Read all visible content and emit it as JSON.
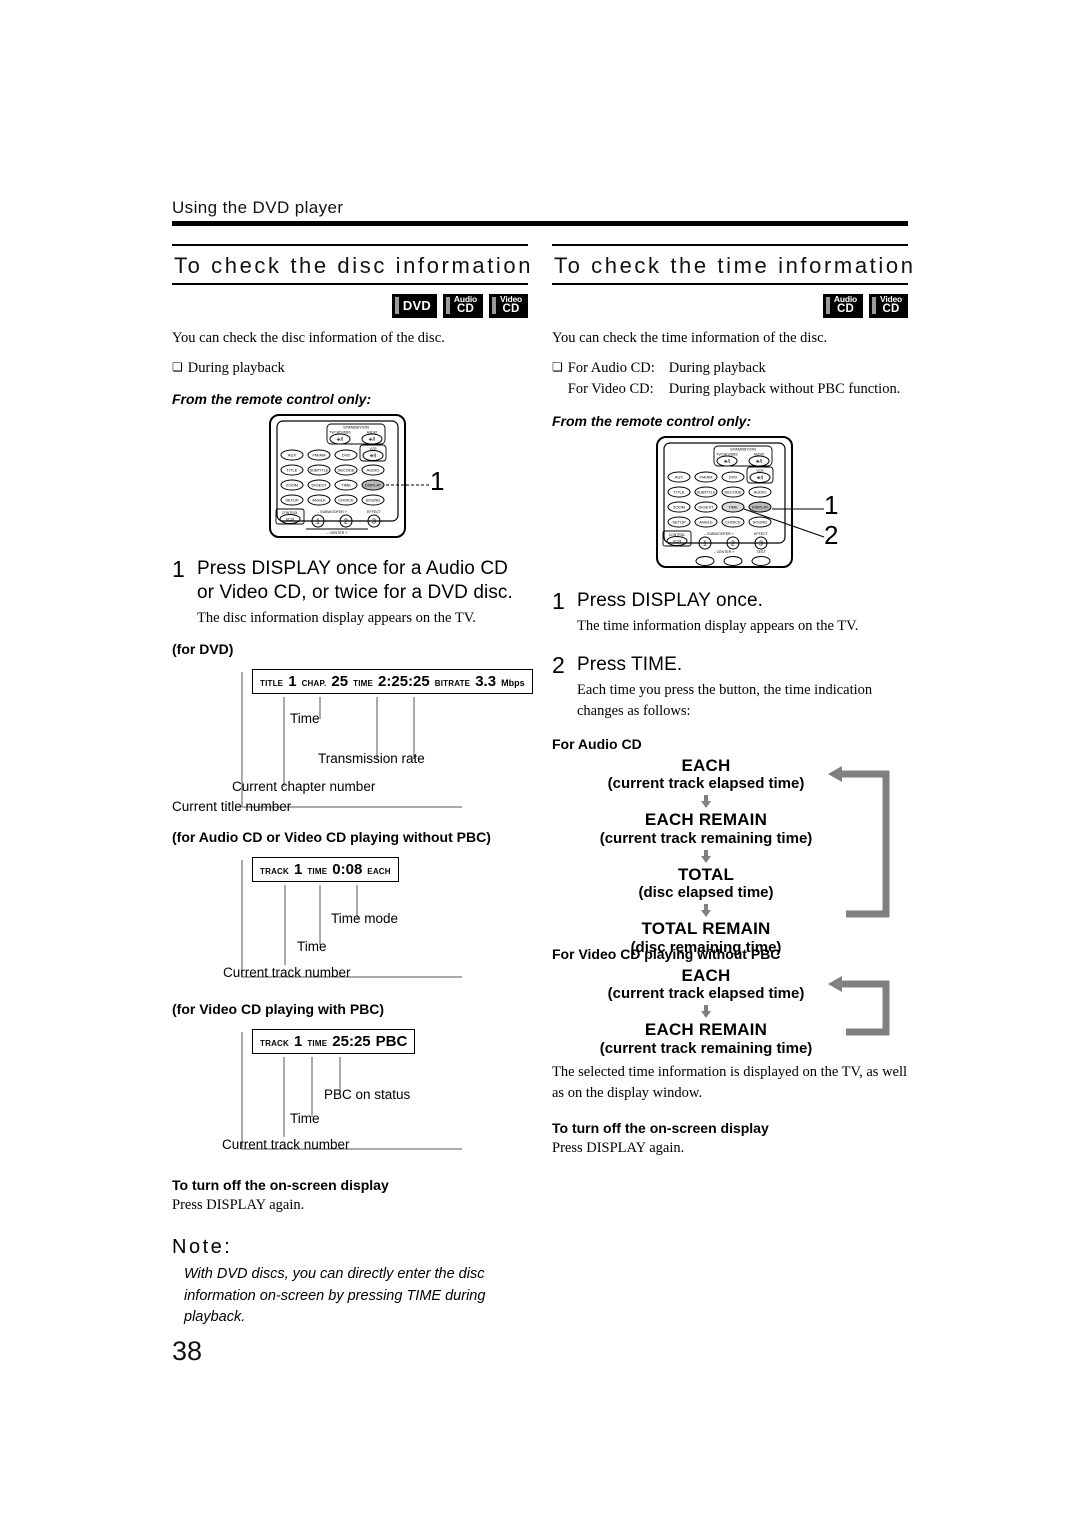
{
  "running_head": "Using the DVD player",
  "page_number": "38",
  "left_column": {
    "heading": "To check the disc information",
    "badges": [
      {
        "name": "dvd-badge",
        "line1": "",
        "line2": "DVD",
        "single": true
      },
      {
        "name": "audio-cd-badge",
        "line1": "Audio",
        "line2": "CD",
        "single": false
      },
      {
        "name": "video-cd-badge",
        "line1": "Video",
        "line2": "CD",
        "single": false
      }
    ],
    "intro": "You can check the disc information of the disc.",
    "condition": "During playback",
    "from_remote": "From the remote control only:",
    "callout_number": "1",
    "step1": {
      "number": "1",
      "title": "Press DISPLAY once for a Audio CD or Video CD, or twice for a DVD disc.",
      "sub": "The disc information display appears on the TV."
    },
    "dvd_label": "(for DVD)",
    "dvd_display": {
      "title_label": "TITLE",
      "title_value": "1",
      "chap_label": "CHAP.",
      "chap_value": "25",
      "time_label": "TIME",
      "time_value": "2:25:25",
      "bitrate_label": "BITRATE",
      "bitrate_value": "3.3",
      "bitrate_unit": "Mbps"
    },
    "dvd_callouts": {
      "time": "Time",
      "transmission": "Transmission rate",
      "chapter": "Current chapter number",
      "title": "Current title number"
    },
    "audio_label": "(for Audio CD or Video CD playing without PBC)",
    "audio_display": {
      "track_label": "TRACK",
      "track_value": "1",
      "time_label": "TIME",
      "time_value": "0:08",
      "mode_value": "EACH"
    },
    "audio_callouts": {
      "mode": "Time mode",
      "time": "Time",
      "track": "Current track number"
    },
    "pbc_label": "(for Video CD playing with PBC)",
    "pbc_display": {
      "track_label": "TRACK",
      "track_value": "1",
      "time_label": "TIME",
      "time_value": "25:25",
      "pbc_value": "PBC"
    },
    "pbc_callouts": {
      "pbc": "PBC on status",
      "time": "Time",
      "track": "Current track number"
    },
    "turnoff_head": "To turn off the on-screen display",
    "turnoff_body": "Press DISPLAY again.",
    "note_head": "Note:",
    "note_body": "With DVD discs, you can directly enter the disc information on-screen by pressing TIME during playback."
  },
  "right_column": {
    "heading": "To check the time information",
    "badges": [
      {
        "name": "audio-cd-badge",
        "line1": "Audio",
        "line2": "CD",
        "single": false
      },
      {
        "name": "video-cd-badge",
        "line1": "Video",
        "line2": "CD",
        "single": false
      }
    ],
    "intro": "You can check the time information of the disc.",
    "cond_audio_key": "For Audio CD:",
    "cond_audio_val": "During playback",
    "cond_video_key": "For Video CD:",
    "cond_video_val": "During playback without PBC function.",
    "from_remote": "From the remote control only:",
    "callout_number_1": "1",
    "callout_number_2": "2",
    "step1": {
      "number": "1",
      "title": "Press DISPLAY once.",
      "sub": "The time information display appears on the TV."
    },
    "step2": {
      "number": "2",
      "title": "Press TIME.",
      "sub": "Each time you press the button, the time indication changes as follows:"
    },
    "flow_audio": {
      "head": "For Audio CD",
      "items": [
        {
          "big": "EACH",
          "sub": "(current track elapsed time)"
        },
        {
          "big": "EACH REMAIN",
          "sub": "(current track remaining time)"
        },
        {
          "big": "TOTAL",
          "sub": "(disc elapsed time)"
        },
        {
          "big": "TOTAL REMAIN",
          "sub": "(disc remaining time)"
        }
      ]
    },
    "flow_video": {
      "head": "For Video CD playing without PBC",
      "items": [
        {
          "big": "EACH",
          "sub": "(current track elapsed time)"
        },
        {
          "big": "EACH REMAIN",
          "sub": "(current track remaining time)"
        }
      ]
    },
    "closing": "The selected time information is displayed on the TV, as well as on the display window.",
    "turnoff_head": "To turn off the on-screen display",
    "turnoff_body": "Press DISPLAY again."
  },
  "remote": {
    "standby_label": "STANDBY/ON",
    "tv_label": "TV/CATV/DBS",
    "audio_label": "AUDIO",
    "vcr_label": "VCR",
    "power_glyph": "⏻/I",
    "rows": [
      [
        "AUX",
        "FM/AM",
        "DVD"
      ],
      [
        "TITLE",
        "SUBTITLE",
        "DECODE",
        "AUDIO"
      ],
      [
        "ZOOM",
        "DIGEST",
        "TIME",
        "DISPLAY"
      ],
      [
        "SETUP",
        "ANGLE",
        "CHOICE",
        "SOUND"
      ]
    ],
    "bottom": {
      "control_label": "CONTROL",
      "control_btn": "VCR",
      "subwoofer_label": "– SUBWOOFER +",
      "effect_label": "EFFECT",
      "center_label": "– CENTER +",
      "test_label": "TEST",
      "nums": [
        "1",
        "2",
        "3"
      ]
    }
  },
  "colors": {
    "ink": "#000000",
    "rule": "#000000",
    "arrow_gray": "#808080",
    "badge_bar": "#9a9a9a"
  }
}
